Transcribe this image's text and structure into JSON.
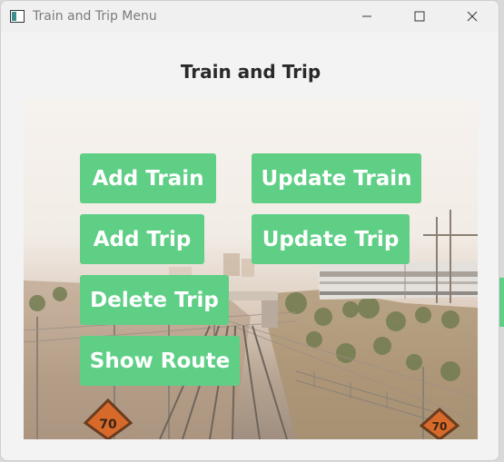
{
  "window": {
    "title": "Train and Trip Menu",
    "icon": "app-window-icon",
    "controls": [
      "minimize-icon",
      "maximize-icon",
      "close-icon"
    ]
  },
  "heading": "Train and Trip",
  "menu": {
    "add_train": "Add Train",
    "update_train": "Update Train",
    "add_trip": "Add Trip",
    "update_trip": "Update Trip",
    "delete_trip": "Delete Trip",
    "show_route": "Show Route"
  },
  "background": {
    "signs": [
      "70",
      "70"
    ]
  },
  "colors": {
    "button": "#5fcf86",
    "button_text": "#ffffff",
    "heading": "#2a2a2a"
  }
}
